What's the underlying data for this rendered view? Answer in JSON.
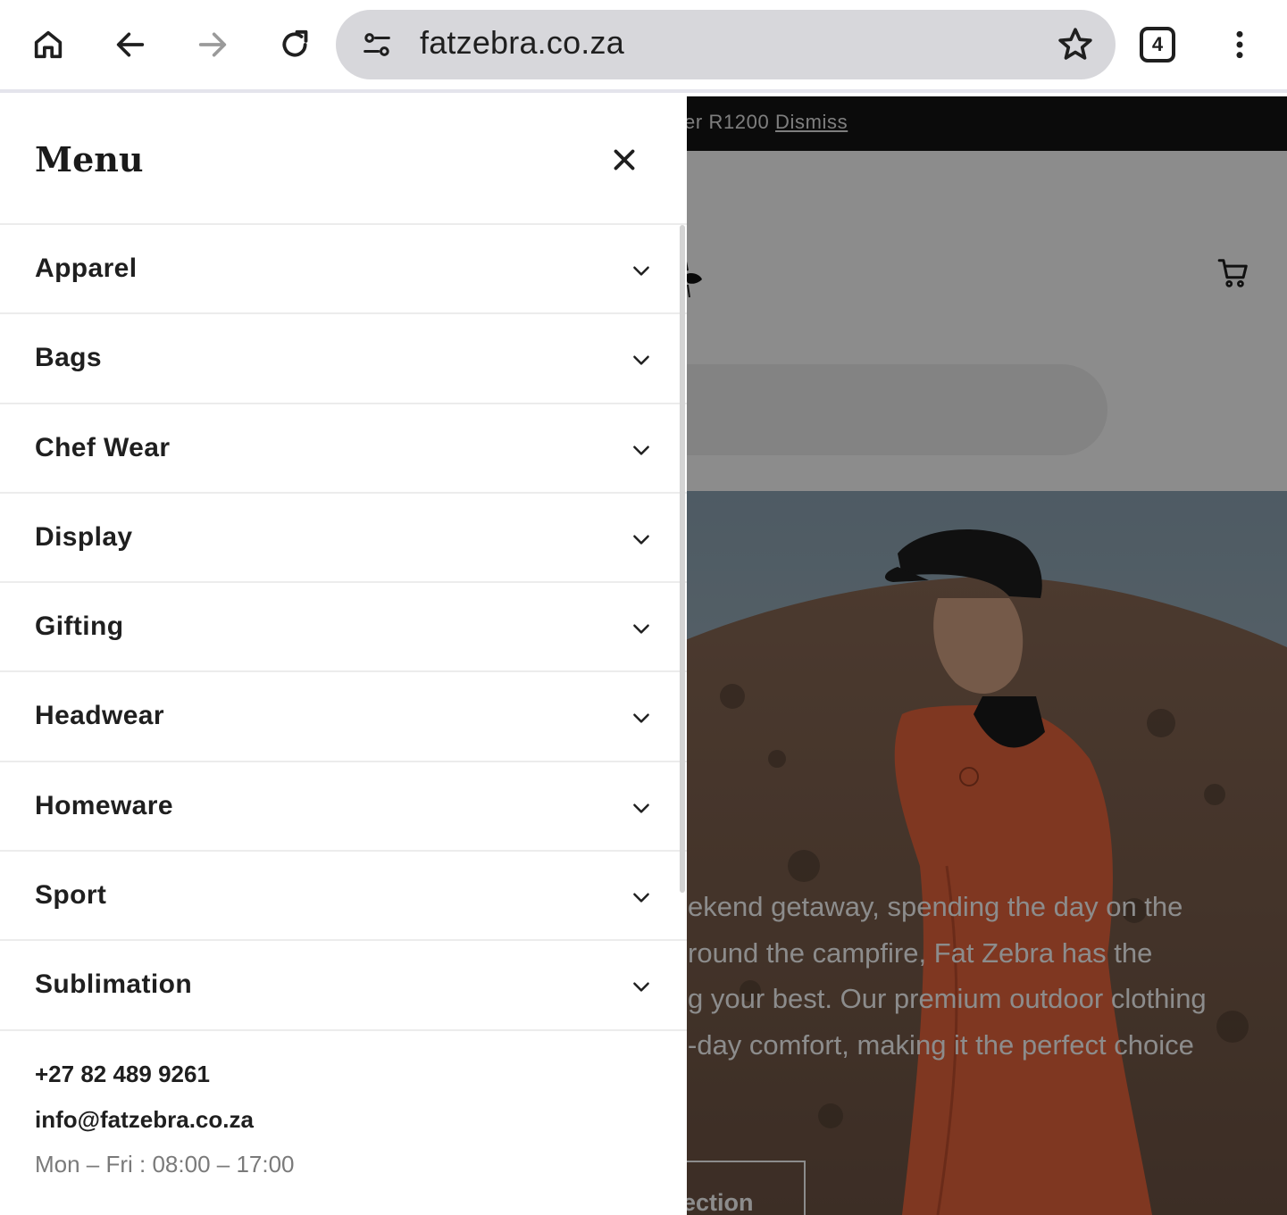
{
  "browser": {
    "url": "fatzebra.co.za",
    "tab_count": "4",
    "icons": [
      "home-icon",
      "back-icon",
      "forward-icon",
      "reload-icon",
      "site-settings-icon",
      "bookmark-star-icon",
      "tab-switcher-icon",
      "more-vert-icon"
    ]
  },
  "background_page": {
    "announcement_text": "er R1200",
    "announcement_link": "Dismiss",
    "hero_lines": [
      "ekend getaway, spending the day on the",
      "round the campfire, Fat Zebra has the",
      "g your best. Our premium outdoor clothing",
      "-day comfort, making it the perfect choice"
    ],
    "hero_button": "ection"
  },
  "drawer": {
    "title": "Menu",
    "items": [
      {
        "label": "Apparel"
      },
      {
        "label": "Bags"
      },
      {
        "label": "Chef Wear"
      },
      {
        "label": "Display"
      },
      {
        "label": "Gifting"
      },
      {
        "label": "Headwear"
      },
      {
        "label": "Homeware"
      },
      {
        "label": "Sport"
      },
      {
        "label": "Sublimation"
      }
    ],
    "contact": {
      "phone": "+27 82 489 9261",
      "email": "info@fatzebra.co.za",
      "hours": "Mon – Fri : 08:00 – 17:00"
    }
  },
  "colors": {
    "announcement_bg": "#151515",
    "overlay": "rgba(0,0,0,0.45)",
    "jacket": "#e8643c"
  }
}
